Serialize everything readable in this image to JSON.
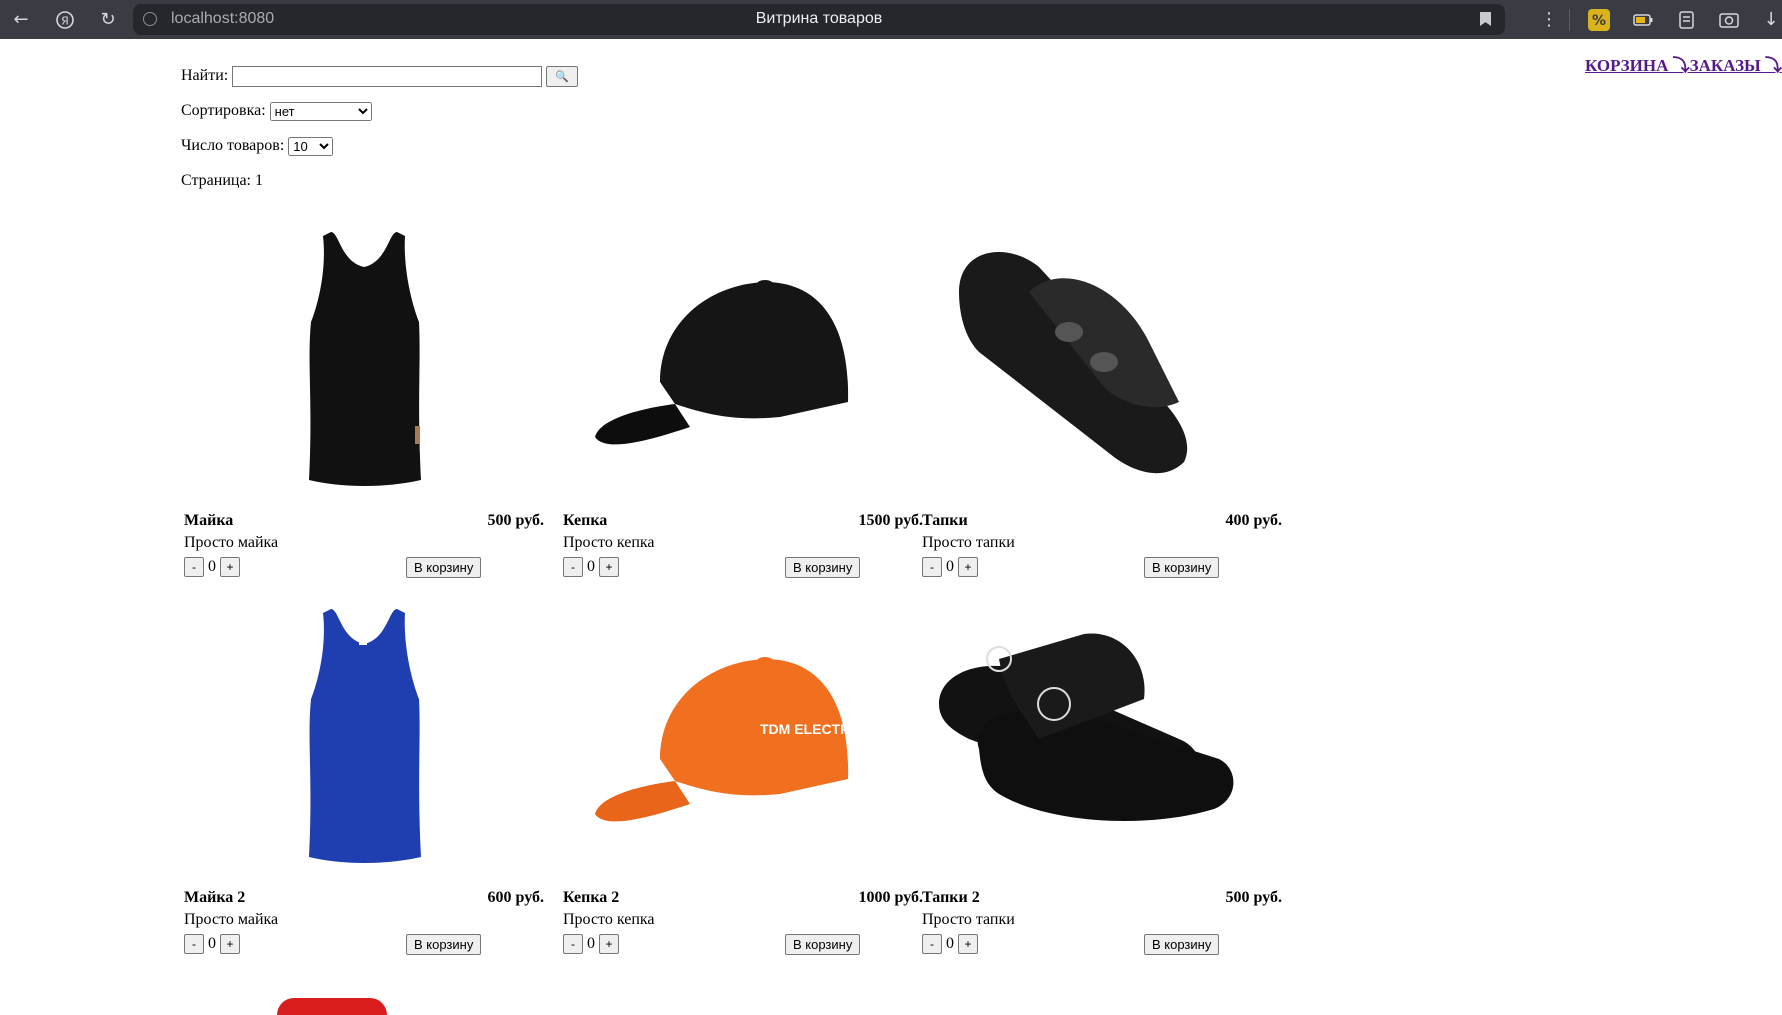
{
  "browser": {
    "url": "localhost:8080",
    "tab_title": "Витрина товаров",
    "icons": [
      "back-arrow-icon",
      "yandex-icon",
      "reload-icon",
      "bookmark-icon",
      "menu-dots-icon",
      "extension-icon",
      "battery-icon",
      "collections-icon",
      "screenshot-icon",
      "download-icon"
    ]
  },
  "search": {
    "label": "Найти:",
    "value": "",
    "button_icon": "🔍"
  },
  "sorting": {
    "label": "Сортировка:",
    "selected": "нет"
  },
  "per_page": {
    "label": "Число товаров:",
    "selected": "10"
  },
  "page": {
    "label": "Страница:",
    "number": "1"
  },
  "nav": {
    "cart": "КОРЗИНА ⤵",
    "orders": "ЗАКАЗЫ ⤵"
  },
  "products": [
    {
      "name": "Майка",
      "price": "500 руб.",
      "description": "Просто майка",
      "qty": "0",
      "image": "black-tank-top",
      "color": "#111111"
    },
    {
      "name": "Кепка",
      "price": "1500 руб.",
      "description": "Просто кепка",
      "qty": "0",
      "image": "black-cap",
      "color": "#151515"
    },
    {
      "name": "Тапки",
      "price": "400 руб.",
      "description": "Просто тапки",
      "qty": "0",
      "image": "black-slide-sandal",
      "color": "#1a1a1a"
    },
    {
      "name": "Майка 2",
      "price": "600 руб.",
      "description": "Просто майка",
      "qty": "0",
      "image": "blue-tank-top",
      "color": "#1f3fb0"
    },
    {
      "name": "Кепка 2",
      "price": "1000 руб.",
      "description": "Просто кепка",
      "qty": "0",
      "image": "orange-cap",
      "color": "#f07020"
    },
    {
      "name": "Тапки 2",
      "price": "500 руб.",
      "description": "Просто тапки",
      "qty": "0",
      "image": "black-slippers",
      "color": "#121212"
    }
  ],
  "labels": {
    "minus": "-",
    "plus": "+",
    "add_to_cart": "В корзину"
  }
}
